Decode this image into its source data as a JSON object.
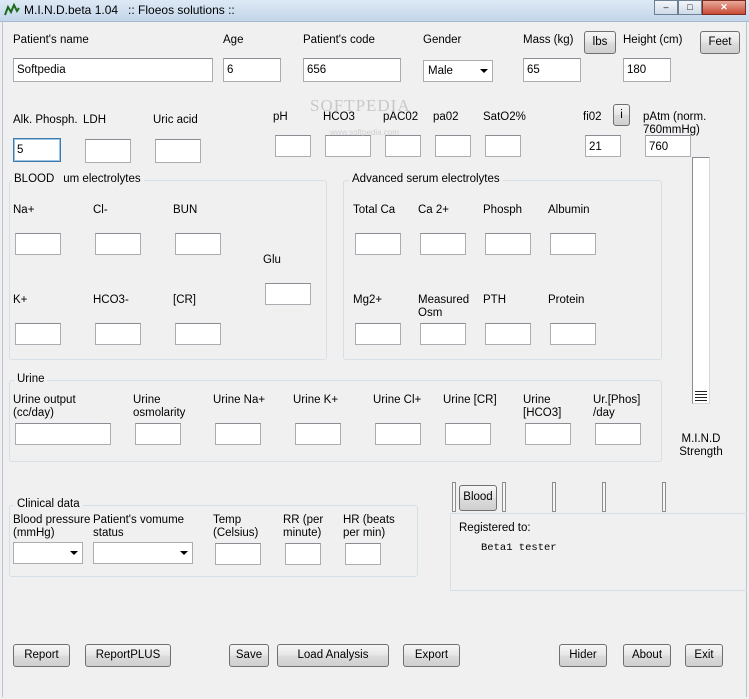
{
  "window": {
    "title": "M.I.N.D.beta 1.04   :: Floeos solutions ::",
    "minimize_glyph": "–",
    "maximize_glyph": "□",
    "close_glyph": "✕"
  },
  "patient": {
    "name_label": "Patient's name",
    "name_value": "Softpedia",
    "age_label": "Age",
    "age_value": "6",
    "code_label": "Patient's code",
    "code_value": "656",
    "gender_label": "Gender",
    "gender_value": "Male",
    "mass_label": "Mass (kg)",
    "mass_value": "65",
    "lbs_button": "lbs",
    "height_label": "Height (cm)",
    "height_value": "180",
    "feet_button": "Feet"
  },
  "labs": {
    "alk_label": "Alk. Phosph.",
    "alk_value": "5",
    "ldh_label": "LDH",
    "uric_label": "Uric acid",
    "ph_label": "pH",
    "hco3_label": "HCO3",
    "paco2_label": "pAC02",
    "pao2_label": "pa02",
    "sato2_label": "SatO2%",
    "fio2_label": "fi02",
    "fio2_value": "21",
    "info_button": "i",
    "patm_label": "pAtm (norm. 760mmHg)",
    "patm_value": "760"
  },
  "watermark": {
    "text": "SOFTPEDIA",
    "subtext": "www.softpedia.com"
  },
  "blood": {
    "group_title": "BLOOD",
    "group_title_rest": "um electrolytes",
    "na_label": "Na+",
    "cl_label": "Cl-",
    "bun_label": "BUN",
    "glu_label": "Glu",
    "k_label": "K+",
    "hco3_label": "HCO3-",
    "cr_label": "[CR]"
  },
  "advanced": {
    "group_title": "Advanced serum electrolytes",
    "total_ca_label": "Total Ca",
    "ca2_label": "Ca 2+",
    "phosph_label": "Phosph",
    "albumin_label": "Albumin",
    "mg_label": "Mg2+",
    "osm_label": "Measured Osm",
    "pth_label": "PTH",
    "protein_label": "Protein"
  },
  "urine": {
    "group_title": "Urine",
    "output_label": "Urine output (cc/day)",
    "osm_label": "Urine osmolarity",
    "na_label": "Urine Na+",
    "k_label": "Urine K+",
    "cl_label": "Urine Cl+",
    "cr_label": "Urine [CR]",
    "hco3_label": "Urine [HCO3]",
    "phos_label": "Ur.[Phos] /day"
  },
  "strength": {
    "label": "M.I.N.D Strength"
  },
  "tabs": {
    "blood_button": "Blood"
  },
  "clinical": {
    "group_title": "Clinical data",
    "bp_label": "Blood pressure (mmHg)",
    "volume_label": "Patient's vomume status",
    "temp_label": "Temp (Celsius)",
    "rr_label": "RR (per minute)",
    "hr_label": "HR (beats per min)"
  },
  "registration": {
    "title": "Registered to:",
    "user": "Beta1 tester"
  },
  "footer": {
    "report": "Report",
    "report_plus": "ReportPLUS",
    "save": "Save",
    "load": "Load Analysis",
    "export": "Export",
    "hider": "Hider",
    "about": "About",
    "exit": "Exit"
  }
}
